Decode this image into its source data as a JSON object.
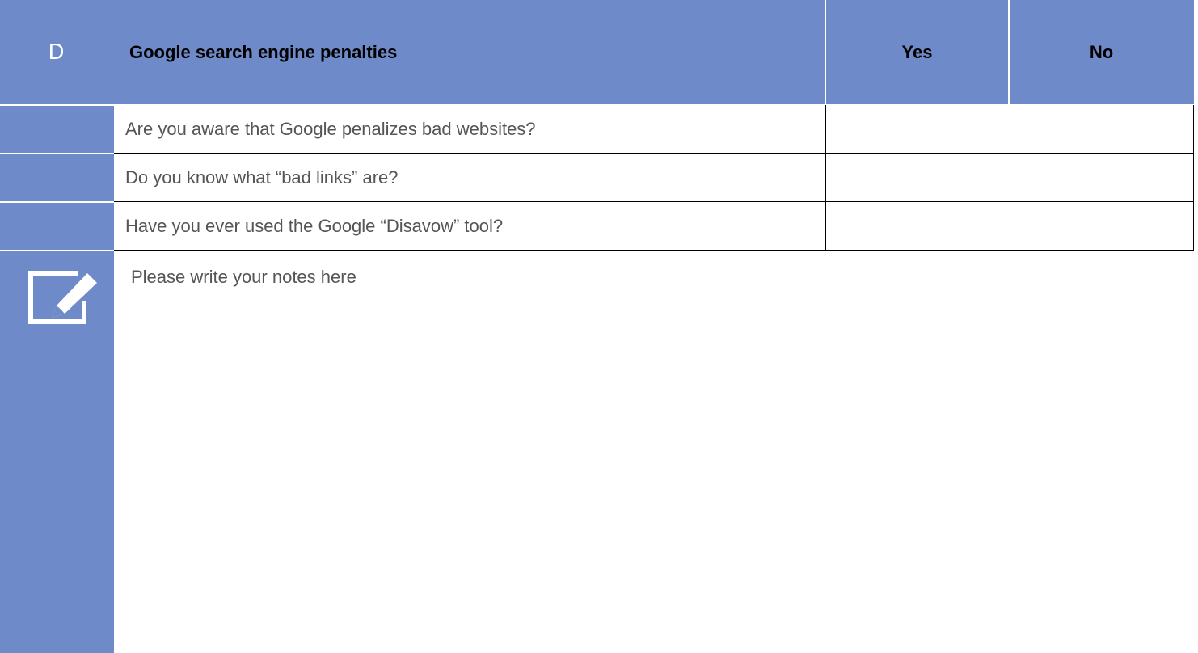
{
  "section": {
    "letter": "D",
    "title": "Google search engine penalties",
    "yes_label": "Yes",
    "no_label": "No"
  },
  "questions": [
    {
      "text": "Are you aware that Google penalizes bad websites?"
    },
    {
      "text": "Do you know what “bad links” are?"
    },
    {
      "text": "Have you ever used the Google “Disavow” tool?"
    }
  ],
  "notes": {
    "icon": "edit-note-icon",
    "placeholder": "Please write your notes here"
  },
  "colors": {
    "accent": "#6f8ac8",
    "question_text": "#555555",
    "header_text": "#000000"
  }
}
